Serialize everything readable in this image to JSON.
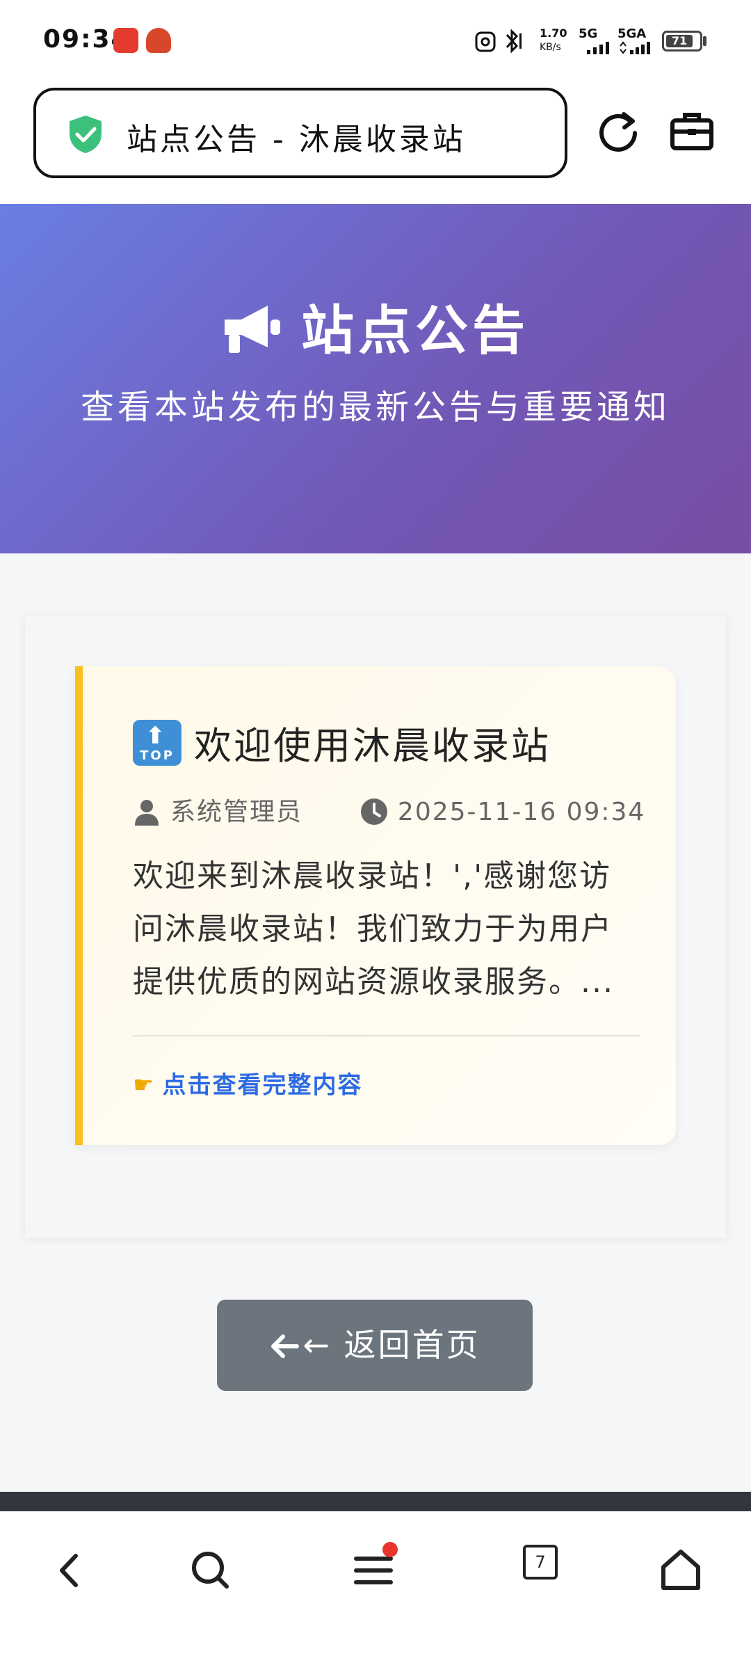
{
  "status_bar": {
    "time": "09:34",
    "net_speed": "1.70",
    "net_unit": "KB/s",
    "sim1": "5G",
    "sim2": "5GA",
    "battery": "71"
  },
  "address_bar": {
    "page_title": "站点公告 - 沐晨收录站"
  },
  "hero": {
    "title": "站点公告",
    "subtitle": "查看本站发布的最新公告与重要通知"
  },
  "announcement": {
    "badge": "TOP",
    "title": "欢迎使用沐晨收录站",
    "author": "系统管理员",
    "datetime": "2025-11-16 09:34",
    "excerpt": "欢迎来到沐晨收录站！','感谢您访问沐晨收录站！我们致力于为用户提供优质的网站资源收录服务。...",
    "read_more": "点击查看完整内容"
  },
  "back_button": {
    "label": "← 返回首页"
  },
  "bottom_nav": {
    "tab_count": "7"
  },
  "colors": {
    "hero_start": "#6a7ee3",
    "hero_end": "#774ea4",
    "card_accent": "#f6c121",
    "link": "#2d6be4",
    "back_button": "#6c757d",
    "shield": "#3cc17d"
  }
}
